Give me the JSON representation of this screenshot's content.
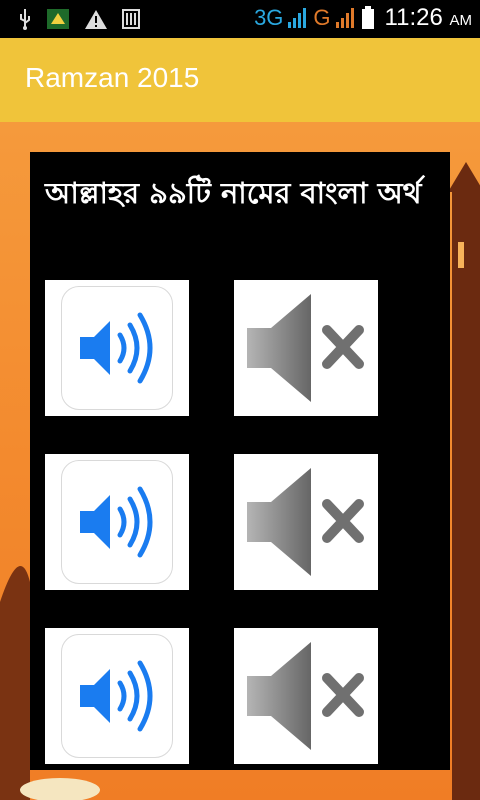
{
  "status_bar": {
    "icons": [
      "usb-icon",
      "app-notification-icon",
      "warning-icon",
      "barcode-icon"
    ],
    "network_3g": "3G",
    "network_g": "G",
    "time": "11:26",
    "ampm": "AM"
  },
  "app_bar": {
    "title": "Ramzan 2015"
  },
  "content": {
    "heading": "আল্লাহর ৯৯টি নামের বাংলা অর্থ",
    "rows": [
      {
        "play_icon": "speaker-volume-icon",
        "mute_icon": "speaker-mute-icon"
      },
      {
        "play_icon": "speaker-volume-icon",
        "mute_icon": "speaker-mute-icon"
      },
      {
        "play_icon": "speaker-volume-icon",
        "mute_icon": "speaker-mute-icon"
      }
    ]
  },
  "colors": {
    "app_bar": "#f0c43a",
    "background": "#f38a2e",
    "volume_blue": "#1a7cf0",
    "mute_gray": "#8a8a8a"
  }
}
